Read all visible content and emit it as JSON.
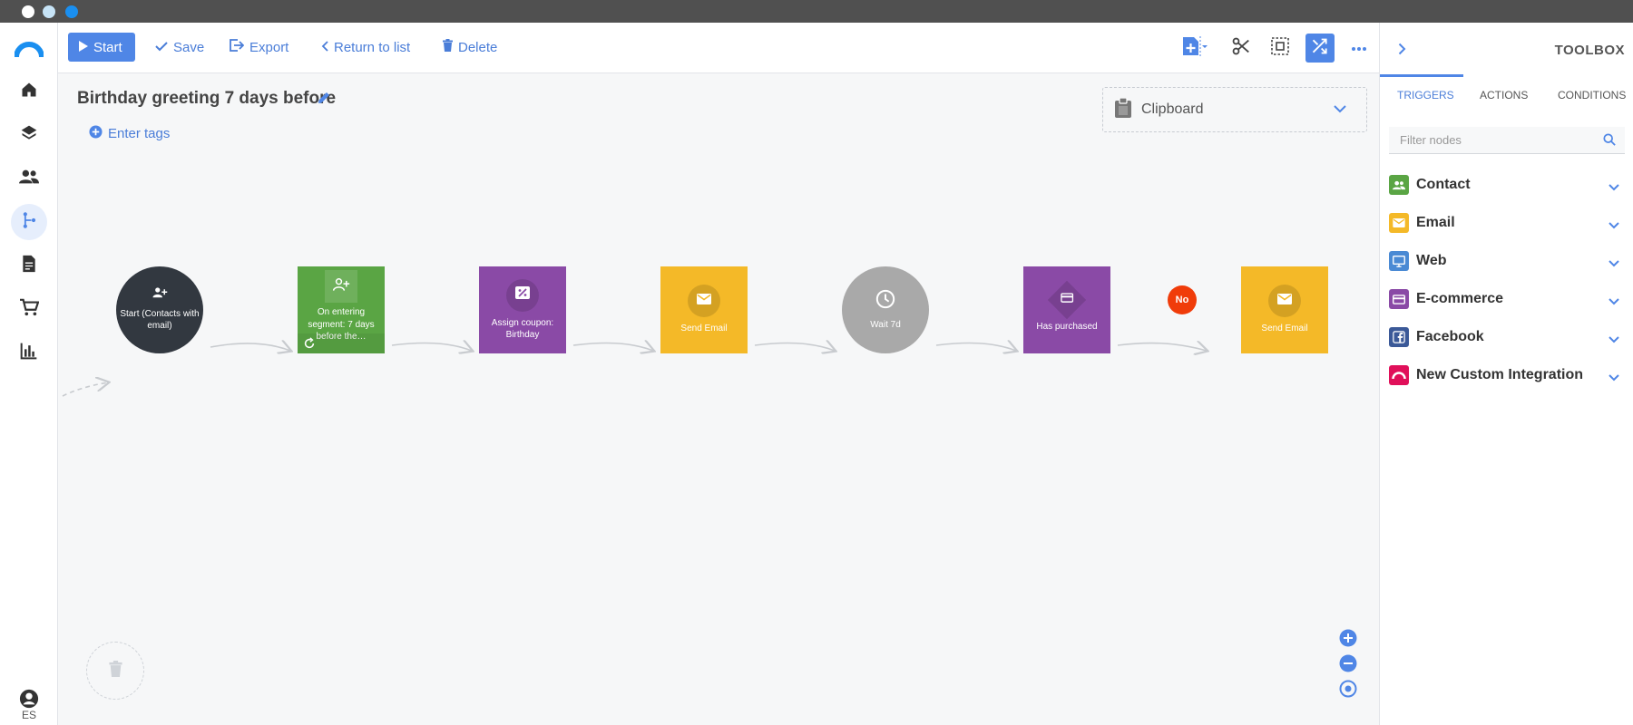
{
  "toolbar": {
    "start_label": "Start",
    "save_label": "Save",
    "export_label": "Export",
    "return_label": "Return to list",
    "delete_label": "Delete"
  },
  "workflow": {
    "title": "Birthday greeting 7 days before",
    "tags_label": "Enter tags"
  },
  "clipboard": {
    "label": "Clipboard"
  },
  "nodes": {
    "start": {
      "label": "Start (Contacts with email)",
      "color": "#323840"
    },
    "segment": {
      "label": "On entering segment: 7 days before the…",
      "color": "#5aa544"
    },
    "coupon": {
      "label": "Assign coupon: Birthday",
      "color": "#8a4aa6"
    },
    "email1": {
      "label": "Send Email",
      "color": "#f4b928"
    },
    "wait": {
      "label": "Wait 7d",
      "color": "#a9a9a9"
    },
    "purchased": {
      "label": "Has purchased",
      "color": "#8a4aa6"
    },
    "no_badge": "No",
    "email2": {
      "label": "Send Email",
      "color": "#f4b928"
    }
  },
  "nav": {
    "lang": "ES"
  },
  "toolbox": {
    "title": "TOOLBOX",
    "tabs": [
      "TRIGGERS",
      "ACTIONS",
      "CONDITIONS"
    ],
    "filter_placeholder": "Filter nodes",
    "categories": [
      {
        "label": "Contact",
        "color": "#5aa544",
        "icon": "people-icon"
      },
      {
        "label": "Email",
        "color": "#f4b928",
        "icon": "envelope-icon"
      },
      {
        "label": "Web",
        "color": "#4a8ad4",
        "icon": "monitor-icon"
      },
      {
        "label": "E-commerce",
        "color": "#8a4aa6",
        "icon": "card-icon"
      },
      {
        "label": "Facebook",
        "color": "#3b5998",
        "icon": "facebook-icon"
      },
      {
        "label": "New Custom Integration",
        "color": "#e0105a",
        "icon": "integration-icon"
      }
    ]
  },
  "colors": {
    "accent": "#4f86e6",
    "no_badge": "#f03c0a"
  }
}
